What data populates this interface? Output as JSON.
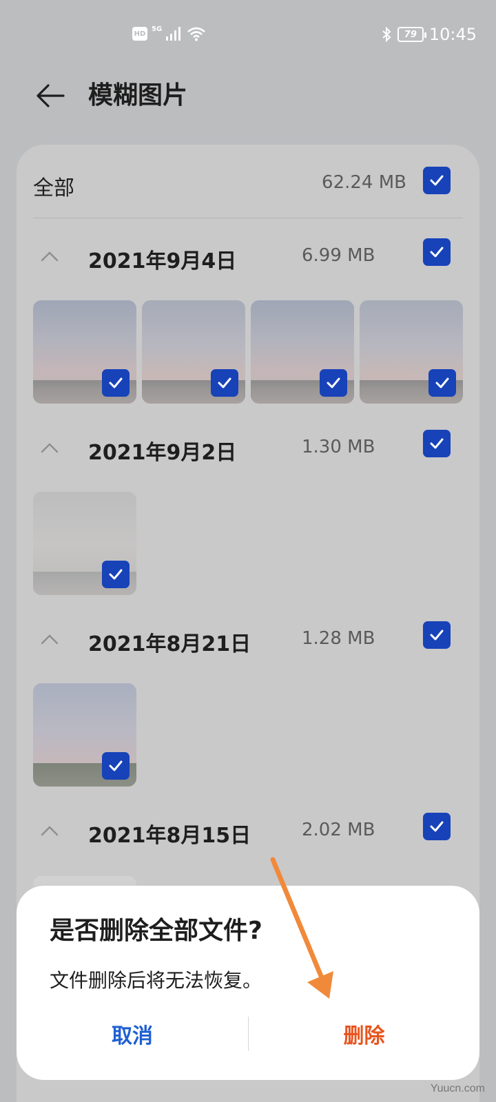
{
  "status_bar": {
    "hd": "HD",
    "network": "5G",
    "battery": "79",
    "time": "10:45"
  },
  "header": {
    "title": "模糊图片"
  },
  "all_row": {
    "label": "全部",
    "size": "62.24 MB",
    "checked": true
  },
  "groups": [
    {
      "date": "2021年9月4日",
      "size": "6.99 MB",
      "checked": true,
      "photo_count": 4
    },
    {
      "date": "2021年9月2日",
      "size": "1.30 MB",
      "checked": true,
      "photo_count": 1
    },
    {
      "date": "2021年8月21日",
      "size": "1.28 MB",
      "checked": true,
      "photo_count": 1
    },
    {
      "date": "2021年8月15日",
      "size": "2.02 MB",
      "checked": true
    }
  ],
  "dialog": {
    "title": "是否删除全部文件?",
    "message": "文件删除后将无法恢复。",
    "cancel_label": "取消",
    "delete_label": "删除"
  },
  "colors": {
    "accent": "#1742b8",
    "cancel": "#1f5fd1",
    "delete": "#e7551e",
    "annotation_arrow": "#f08a3a"
  },
  "watermark": "Yuucn.com"
}
